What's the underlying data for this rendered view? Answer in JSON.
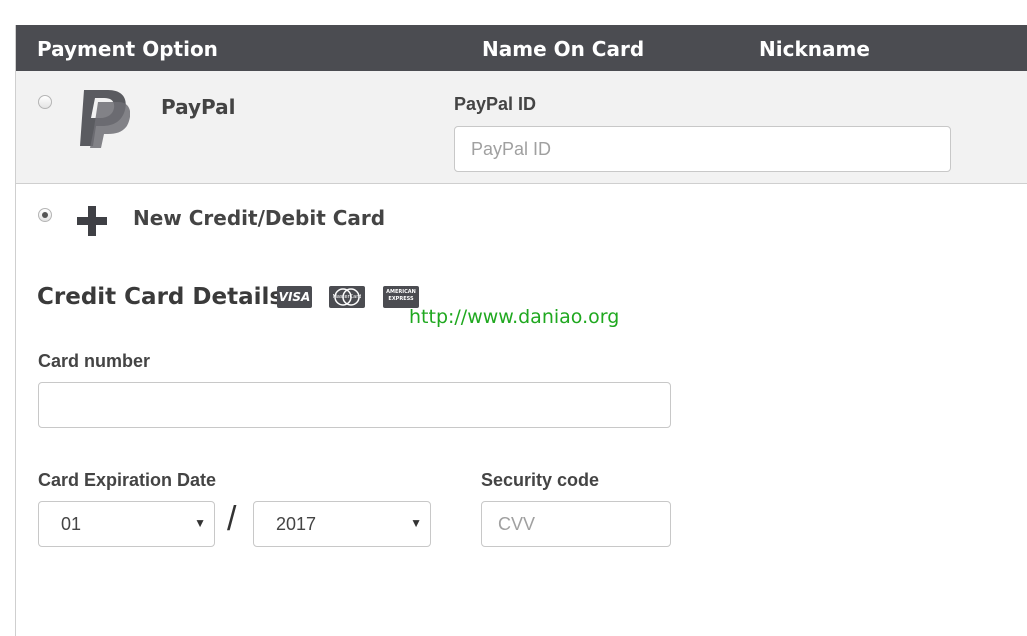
{
  "header": {
    "col_payment_option": "Payment Option",
    "col_name_on_card": "Name On Card",
    "col_nickname": "Nickname",
    "background": "#4b4c51"
  },
  "paypal": {
    "label": "PayPal",
    "icon": "paypal-logo-icon",
    "id_label": "PayPal ID",
    "id_placeholder": "PayPal ID",
    "id_value": "",
    "selected": false
  },
  "new_card": {
    "label": "New Credit/Debit Card",
    "icon": "plus-icon",
    "selected": true
  },
  "card_details": {
    "title": "Credit Card Details",
    "brands": [
      {
        "name": "visa-icon",
        "text": "VISA"
      },
      {
        "name": "mastercard-icon",
        "text": "MasterCard"
      },
      {
        "name": "amex-icon",
        "text": "AMERICAN EXPRESS"
      }
    ],
    "card_number_label": "Card number",
    "card_number_value": "",
    "expiration_label": "Card Expiration Date",
    "exp_month": "01",
    "exp_separator": "/",
    "exp_year": "2017",
    "security_label": "Security code",
    "cvv_placeholder": "CVV"
  },
  "watermark": {
    "text": "http://www.daniao.org",
    "color": "#1fa81f"
  }
}
